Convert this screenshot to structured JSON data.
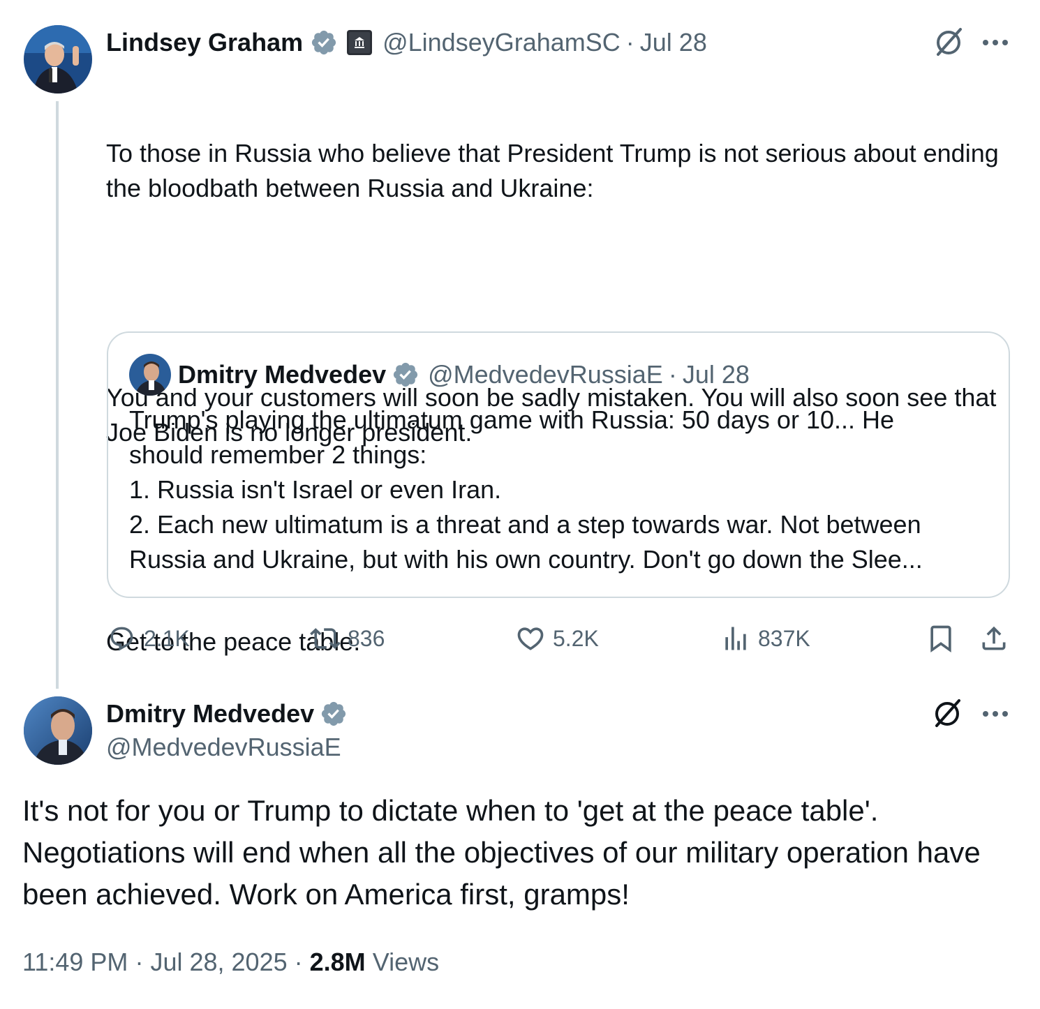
{
  "parent": {
    "name": "Lindsey Graham",
    "handle": "@LindseyGrahamSC",
    "sep": "·",
    "date": "Jul 28",
    "text_p1": "To those in Russia who believe that President Trump is not serious about ending the bloodbath between Russia and Ukraine:",
    "text_p2": "You and your customers will soon be sadly mistaken. You will also soon see that Joe Biden is no longer president.",
    "text_p3": "Get to the peace table.",
    "quote": {
      "name": "Dmitry Medvedev",
      "handle": "@MedvedevRussiaE",
      "sep": "·",
      "date": "Jul 28",
      "line1": "Trump's playing the ultimatum game with Russia: 50 days or 10... He",
      "line2": "should remember 2 things:",
      "line3": "1. Russia isn't Israel or even Iran.",
      "line4": "2. Each new ultimatum is a threat and a step towards war. Not between",
      "line5": "Russia and Ukraine, but with his own country. Don't go down the Slee..."
    },
    "stats": {
      "replies": "2.1K",
      "reposts": "836",
      "likes": "5.2K",
      "views": "837K"
    }
  },
  "main": {
    "name": "Dmitry Medvedev",
    "handle": "@MedvedevRussiaE",
    "text": "It's not for you or Trump to dictate when to 'get at the peace table'. Negotiations will end when all the objectives of our military operation have been achieved. Work on America first, gramps!",
    "time": "11:49 PM",
    "sep1": "·",
    "date": "Jul 28, 2025",
    "sep2": "·",
    "views_count": "2.8M",
    "views_label": "Views"
  },
  "colors": {
    "verified": "#829aab",
    "muted": "#536471",
    "border": "#cfd9de",
    "text": "#0f1419"
  }
}
